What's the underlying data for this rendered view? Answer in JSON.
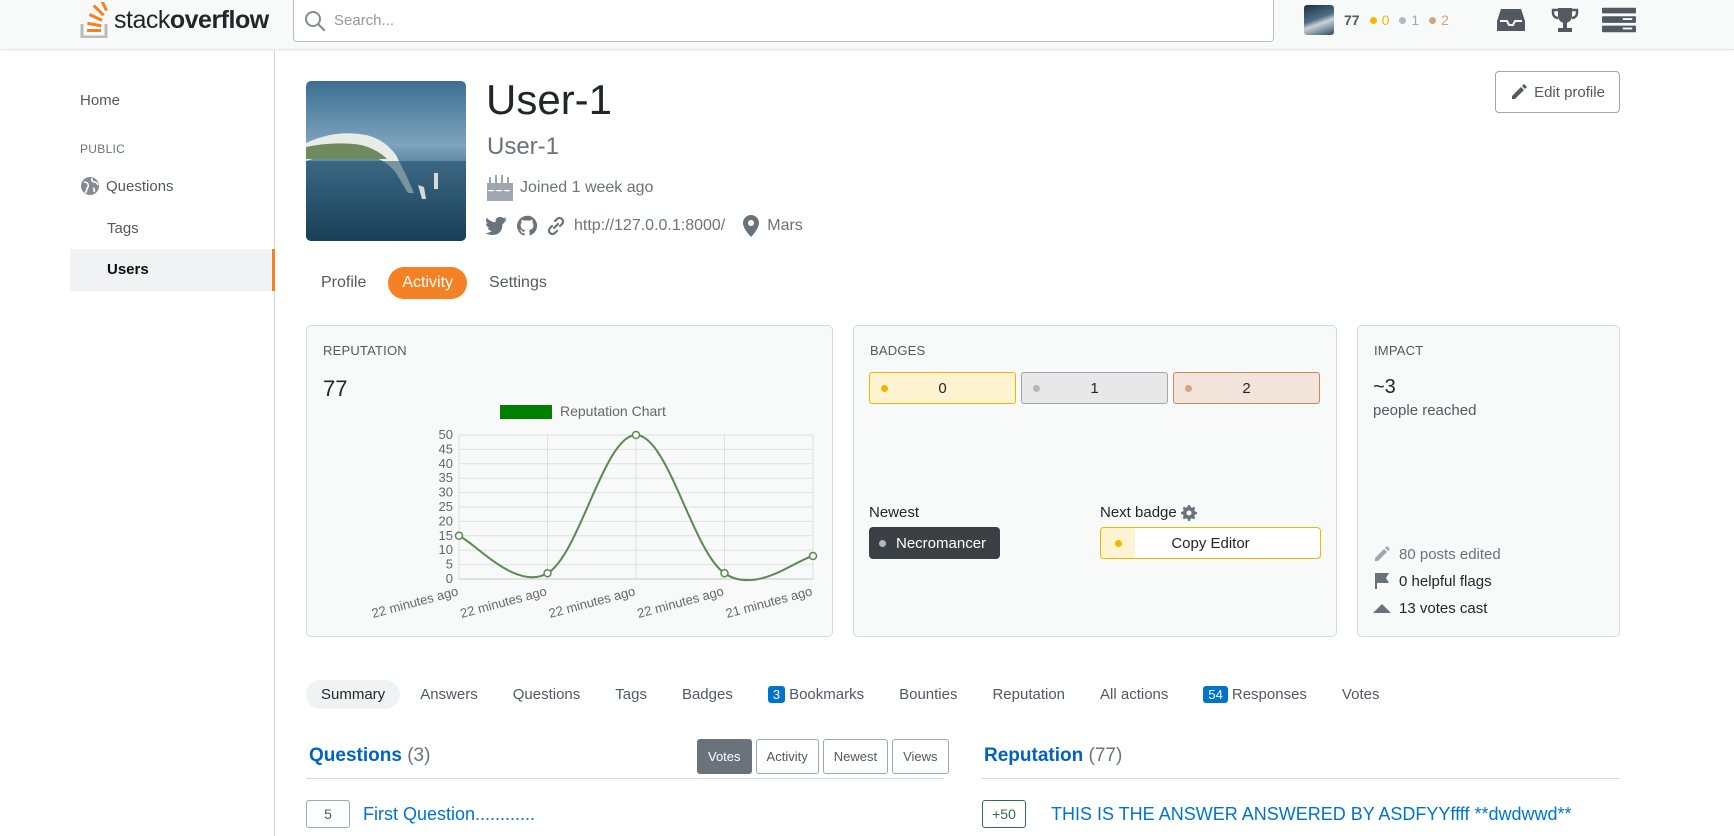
{
  "brand": {
    "name_plain": "stack",
    "name_bold": "overflow"
  },
  "search": {
    "placeholder": "Search..."
  },
  "topbar_user": {
    "reputation": "77",
    "gold": "0",
    "silver": "1",
    "bronze": "2"
  },
  "topbar_icons": [
    "inbox-icon",
    "trophy-icon",
    "site-switcher-icon"
  ],
  "nav": {
    "home": "Home",
    "public": "PUBLIC",
    "questions": "Questions",
    "tags": "Tags",
    "users": "Users"
  },
  "profile": {
    "name": "User-1",
    "title": "User-1",
    "joined": "Joined 1 week ago",
    "website": "http://127.0.0.1:8000/",
    "location": "Mars",
    "edit_label": "Edit profile"
  },
  "profile_tabs": [
    {
      "label": "Profile",
      "active": false
    },
    {
      "label": "Activity",
      "active": true
    },
    {
      "label": "Settings",
      "active": false
    }
  ],
  "reputation_card": {
    "title": "REPUTATION",
    "value": "77"
  },
  "chart_data": {
    "type": "line",
    "legend": "Reputation Chart",
    "legend_color": "#008000",
    "line_color": "#5a8a4f",
    "categories": [
      "22 minutes ago",
      "22 minutes ago",
      "22 minutes ago",
      "22 minutes ago",
      "21 minutes ago"
    ],
    "values": [
      15,
      2,
      50,
      2,
      8
    ],
    "yticks": [
      "0",
      "5",
      "10",
      "15",
      "20",
      "25",
      "30",
      "35",
      "40",
      "45",
      "50"
    ],
    "ylim": [
      0,
      50
    ],
    "grid": true
  },
  "badges_card": {
    "title": "BADGES",
    "gold": "0",
    "silver": "1",
    "bronze": "2",
    "newest_label": "Newest",
    "newest_badge": "Necromancer",
    "next_label": "Next badge",
    "next_badge": "Copy Editor"
  },
  "impact_card": {
    "title": "IMPACT",
    "value": "~3",
    "subtitle": "people reached",
    "posts_edited": "80 posts edited",
    "helpful_flags": "0 helpful flags",
    "votes_cast": "13 votes cast"
  },
  "activity_tabs": [
    {
      "label": "Summary",
      "active": true,
      "count": ""
    },
    {
      "label": "Answers",
      "active": false,
      "count": ""
    },
    {
      "label": "Questions",
      "active": false,
      "count": ""
    },
    {
      "label": "Tags",
      "active": false,
      "count": ""
    },
    {
      "label": "Badges",
      "active": false,
      "count": ""
    },
    {
      "label": "Bookmarks",
      "active": false,
      "count": "3"
    },
    {
      "label": "Bounties",
      "active": false,
      "count": ""
    },
    {
      "label": "Reputation",
      "active": false,
      "count": ""
    },
    {
      "label": "All actions",
      "active": false,
      "count": ""
    },
    {
      "label": "Responses",
      "active": false,
      "count": "54"
    },
    {
      "label": "Votes",
      "active": false,
      "count": ""
    }
  ],
  "questions_section": {
    "title": "Questions",
    "count": "(3)",
    "sort_options": [
      "Votes",
      "Activity",
      "Newest",
      "Views"
    ],
    "selected_sort": "Votes",
    "items": [
      {
        "score": "5",
        "title": "First Question............"
      }
    ]
  },
  "reputation_section": {
    "title": "Reputation",
    "count": "(77)",
    "items": [
      {
        "delta": "+50",
        "title": "THIS IS THE ANSWER ANSWERED BY ASDFYYffff **dwdwwd**"
      }
    ]
  }
}
